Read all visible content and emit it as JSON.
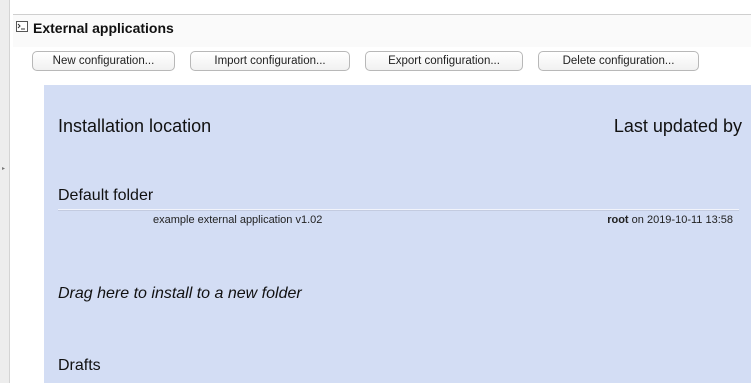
{
  "panel": {
    "title": "External applications",
    "toolbar": {
      "new_label": "New configuration...",
      "import_label": "Import configuration...",
      "export_label": "Export configuration...",
      "delete_label": "Delete configuration..."
    }
  },
  "columns": {
    "location": "Installation location",
    "updated_by": "Last updated by"
  },
  "folders": [
    {
      "name": "Default folder",
      "apps": [
        {
          "name": "example external application v1.02",
          "user": "root",
          "on_label": " on ",
          "timestamp": "2019-10-11 13:58"
        }
      ]
    },
    {
      "name": "Drafts",
      "apps": []
    }
  ],
  "drop_hint": "Drag here to install to a new folder",
  "icons": {
    "panel_icon": "terminal-icon",
    "sidebar_handle": "chevron-right-icon"
  },
  "colors": {
    "content_background": "#d3ddf4",
    "button_border": "#b8b8b8"
  }
}
